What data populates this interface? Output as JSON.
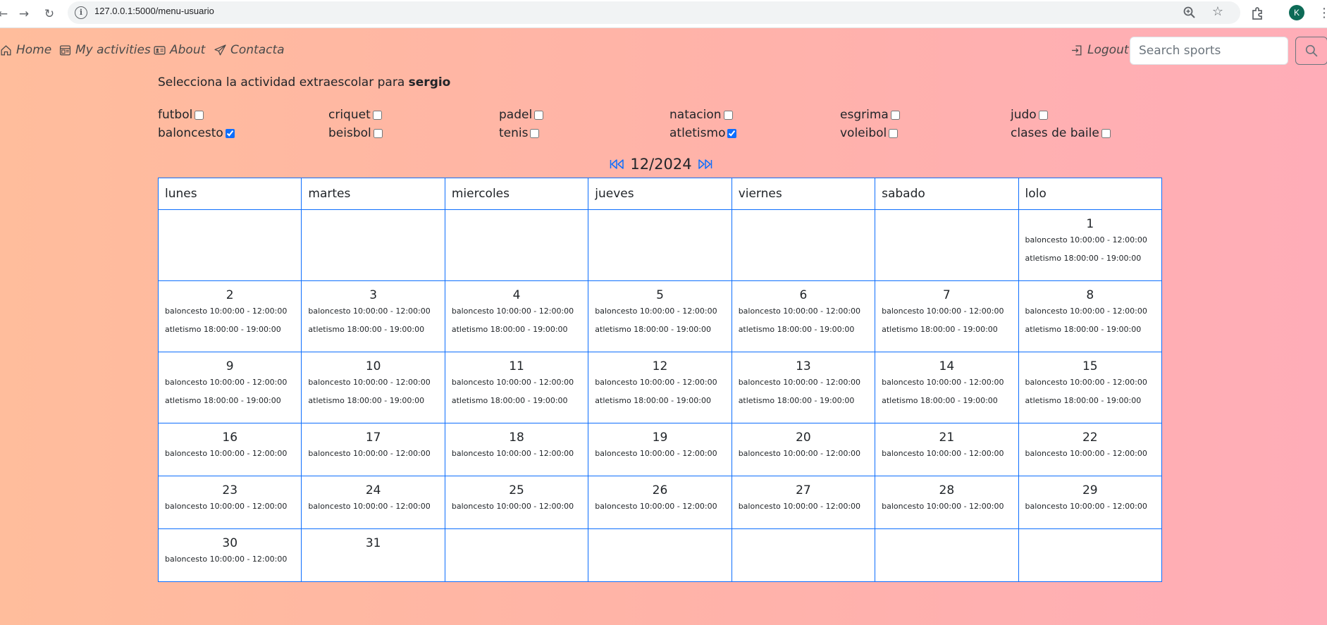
{
  "browser": {
    "url": "127.0.0.1:5000/menu-usuario",
    "avatar_letter": "K"
  },
  "nav": {
    "home": "Home",
    "activities": "My activities",
    "about": "About",
    "contact": "Contacta",
    "logout": "Logout",
    "search_placeholder": "Search sports"
  },
  "intro": {
    "prefix": "Selecciona la actividad extraescolar para",
    "user": "sergio"
  },
  "activities": [
    {
      "label": "futbol",
      "checked": false
    },
    {
      "label": "criquet",
      "checked": false
    },
    {
      "label": "padel",
      "checked": false
    },
    {
      "label": "natacion",
      "checked": false
    },
    {
      "label": "esgrima",
      "checked": false
    },
    {
      "label": "judo",
      "checked": false
    },
    {
      "label": "baloncesto",
      "checked": true
    },
    {
      "label": "beisbol",
      "checked": false
    },
    {
      "label": "tenis",
      "checked": false
    },
    {
      "label": "atletismo",
      "checked": true
    },
    {
      "label": "voleibol",
      "checked": false
    },
    {
      "label": "clases de baile",
      "checked": false
    }
  ],
  "calendar": {
    "month_label": "12/2024",
    "weekdays": [
      "lunes",
      "martes",
      "miercoles",
      "jueves",
      "viernes",
      "sabado",
      "lolo"
    ],
    "weeks": [
      [
        null,
        null,
        null,
        null,
        null,
        null,
        {
          "day": "1",
          "events": [
            "baloncesto 10:00:00 - 12:00:00",
            "atletismo 18:00:00 - 19:00:00"
          ]
        }
      ],
      [
        {
          "day": "2",
          "events": [
            "baloncesto 10:00:00 - 12:00:00",
            "atletismo 18:00:00 - 19:00:00"
          ]
        },
        {
          "day": "3",
          "events": [
            "baloncesto 10:00:00 - 12:00:00",
            "atletismo 18:00:00 - 19:00:00"
          ]
        },
        {
          "day": "4",
          "events": [
            "baloncesto 10:00:00 - 12:00:00",
            "atletismo 18:00:00 - 19:00:00"
          ]
        },
        {
          "day": "5",
          "events": [
            "baloncesto 10:00:00 - 12:00:00",
            "atletismo 18:00:00 - 19:00:00"
          ]
        },
        {
          "day": "6",
          "events": [
            "baloncesto 10:00:00 - 12:00:00",
            "atletismo 18:00:00 - 19:00:00"
          ]
        },
        {
          "day": "7",
          "events": [
            "baloncesto 10:00:00 - 12:00:00",
            "atletismo 18:00:00 - 19:00:00"
          ]
        },
        {
          "day": "8",
          "events": [
            "baloncesto 10:00:00 - 12:00:00",
            "atletismo 18:00:00 - 19:00:00"
          ]
        }
      ],
      [
        {
          "day": "9",
          "events": [
            "baloncesto 10:00:00 - 12:00:00",
            "atletismo 18:00:00 - 19:00:00"
          ]
        },
        {
          "day": "10",
          "events": [
            "baloncesto 10:00:00 - 12:00:00",
            "atletismo 18:00:00 - 19:00:00"
          ]
        },
        {
          "day": "11",
          "events": [
            "baloncesto 10:00:00 - 12:00:00",
            "atletismo 18:00:00 - 19:00:00"
          ]
        },
        {
          "day": "12",
          "events": [
            "baloncesto 10:00:00 - 12:00:00",
            "atletismo 18:00:00 - 19:00:00"
          ]
        },
        {
          "day": "13",
          "events": [
            "baloncesto 10:00:00 - 12:00:00",
            "atletismo 18:00:00 - 19:00:00"
          ]
        },
        {
          "day": "14",
          "events": [
            "baloncesto 10:00:00 - 12:00:00",
            "atletismo 18:00:00 - 19:00:00"
          ]
        },
        {
          "day": "15",
          "events": [
            "baloncesto 10:00:00 - 12:00:00",
            "atletismo 18:00:00 - 19:00:00"
          ]
        }
      ],
      [
        {
          "day": "16",
          "events": [
            "baloncesto 10:00:00 - 12:00:00"
          ]
        },
        {
          "day": "17",
          "events": [
            "baloncesto 10:00:00 - 12:00:00"
          ]
        },
        {
          "day": "18",
          "events": [
            "baloncesto 10:00:00 - 12:00:00"
          ]
        },
        {
          "day": "19",
          "events": [
            "baloncesto 10:00:00 - 12:00:00"
          ]
        },
        {
          "day": "20",
          "events": [
            "baloncesto 10:00:00 - 12:00:00"
          ]
        },
        {
          "day": "21",
          "events": [
            "baloncesto 10:00:00 - 12:00:00"
          ]
        },
        {
          "day": "22",
          "events": [
            "baloncesto 10:00:00 - 12:00:00"
          ]
        }
      ],
      [
        {
          "day": "23",
          "events": [
            "baloncesto 10:00:00 - 12:00:00"
          ]
        },
        {
          "day": "24",
          "events": [
            "baloncesto 10:00:00 - 12:00:00"
          ]
        },
        {
          "day": "25",
          "events": [
            "baloncesto 10:00:00 - 12:00:00"
          ]
        },
        {
          "day": "26",
          "events": [
            "baloncesto 10:00:00 - 12:00:00"
          ]
        },
        {
          "day": "27",
          "events": [
            "baloncesto 10:00:00 - 12:00:00"
          ]
        },
        {
          "day": "28",
          "events": [
            "baloncesto 10:00:00 - 12:00:00"
          ]
        },
        {
          "day": "29",
          "events": [
            "baloncesto 10:00:00 - 12:00:00"
          ]
        }
      ],
      [
        {
          "day": "30",
          "events": [
            "baloncesto 10:00:00 - 12:00:00"
          ]
        },
        {
          "day": "31",
          "events": []
        },
        null,
        null,
        null,
        null,
        null
      ]
    ]
  },
  "colors": {
    "accent": "#0d6efd",
    "gradient_start": "#ffbd9c",
    "gradient_end": "#ffadb8"
  }
}
